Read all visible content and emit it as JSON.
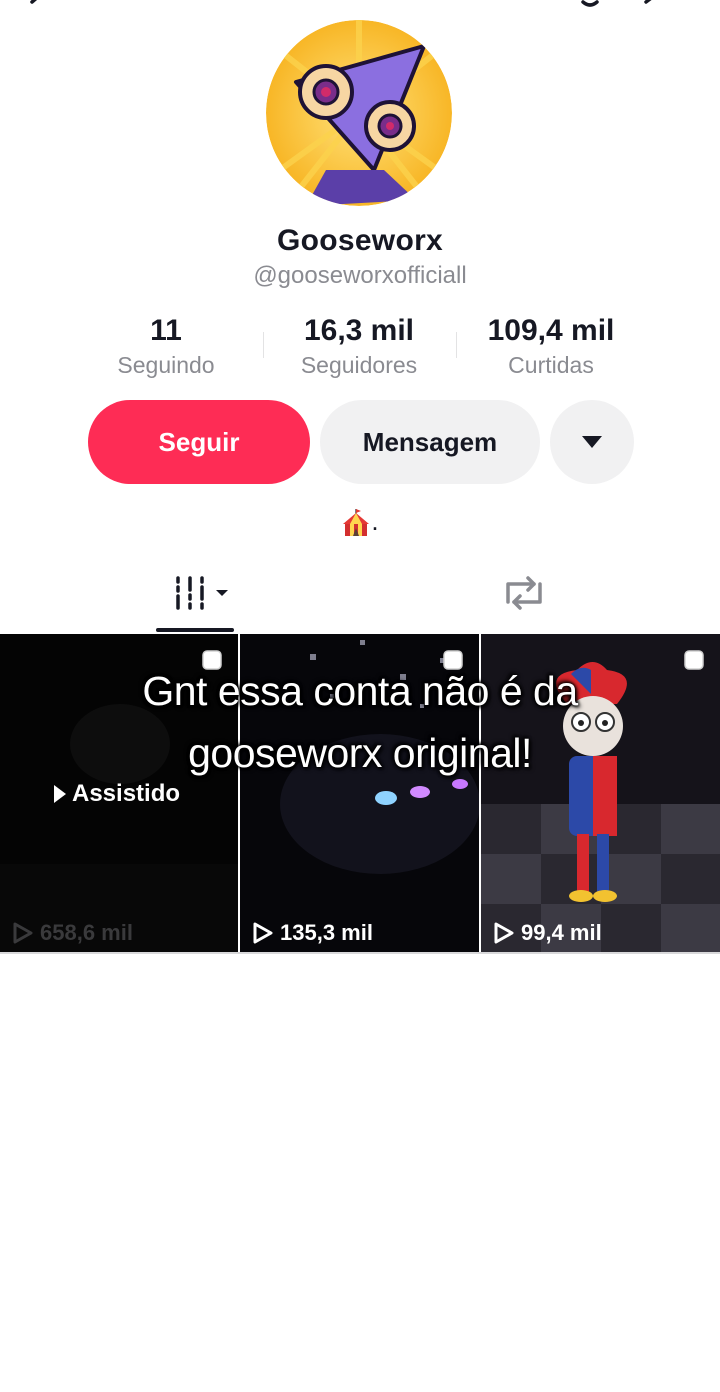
{
  "profile": {
    "display_name": "Gooseworx",
    "username": "@gooseworxofficiall",
    "bio": "."
  },
  "stats": [
    {
      "value": "11",
      "label": "Seguindo"
    },
    {
      "value": "16,3 mil",
      "label": "Seguidores"
    },
    {
      "value": "109,4 mil",
      "label": "Curtidas"
    }
  ],
  "actions": {
    "follow_label": "Seguir",
    "message_label": "Mensagem"
  },
  "videos": [
    {
      "views": "658,6 mil",
      "watched_label": "Assistido",
      "pinned": true
    },
    {
      "views": "135,3 mil",
      "pinned": true
    },
    {
      "views": "99,4 mil",
      "pinned": true
    }
  ],
  "overlay_caption": "Gnt essa conta não é da gooseworx original!",
  "colors": {
    "accent": "#fe2c55",
    "secondary_button": "#f1f1f2",
    "text_primary": "#161823",
    "text_secondary": "#8a8b91"
  },
  "icons": [
    "back-icon",
    "bell-icon",
    "share-icon",
    "tent-icon",
    "grid-tab-icon",
    "repost-icon",
    "pin-icon",
    "play-icon"
  ]
}
